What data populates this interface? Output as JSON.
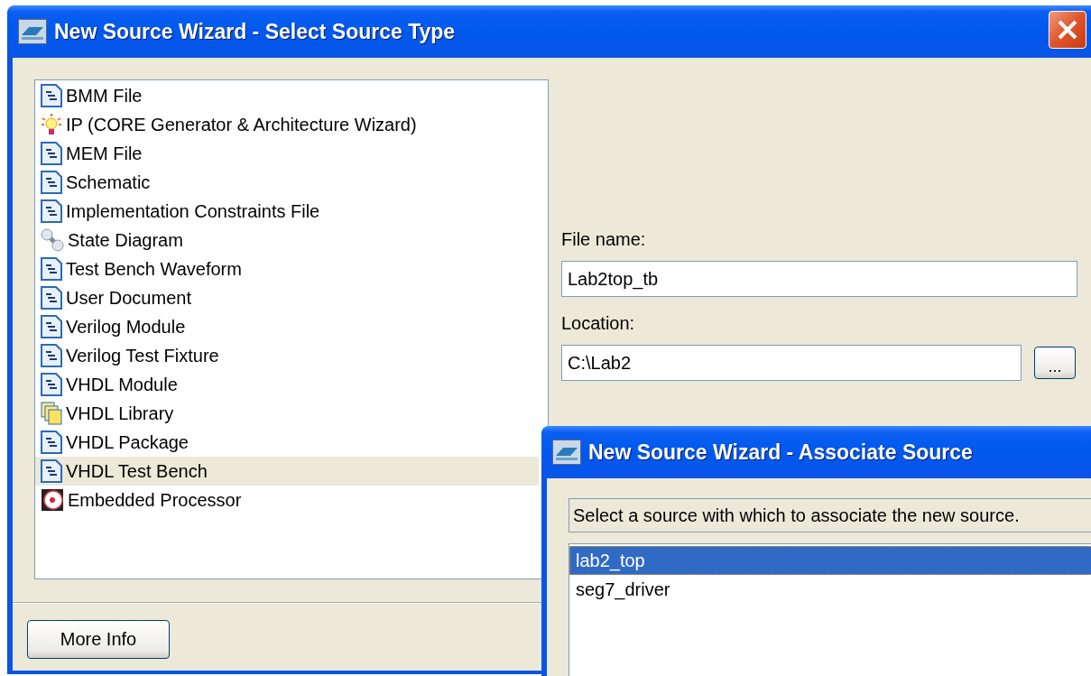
{
  "main_window": {
    "title": "New Source Wizard - Select Source Type",
    "source_types": [
      {
        "label": "BMM File",
        "kind": "document",
        "selected": false
      },
      {
        "label": "IP (CORE Generator & Architecture Wizard)",
        "kind": "bulb",
        "selected": false
      },
      {
        "label": "MEM File",
        "kind": "document",
        "selected": false
      },
      {
        "label": "Schematic",
        "kind": "document",
        "selected": false
      },
      {
        "label": "Implementation Constraints File",
        "kind": "document",
        "selected": false
      },
      {
        "label": "State Diagram",
        "kind": "circles",
        "selected": false
      },
      {
        "label": "Test Bench Waveform",
        "kind": "document",
        "selected": false
      },
      {
        "label": "User Document",
        "kind": "document",
        "selected": false
      },
      {
        "label": "Verilog Module",
        "kind": "document",
        "selected": false
      },
      {
        "label": "Verilog Test Fixture",
        "kind": "document",
        "selected": false
      },
      {
        "label": "VHDL Module",
        "kind": "document",
        "selected": false
      },
      {
        "label": "VHDL Library",
        "kind": "pages",
        "selected": false
      },
      {
        "label": "VHDL Package",
        "kind": "document",
        "selected": false
      },
      {
        "label": "VHDL Test Bench",
        "kind": "document",
        "selected": true
      },
      {
        "label": "Embedded Processor",
        "kind": "disc",
        "selected": false
      }
    ],
    "file_name": {
      "label": "File name:",
      "value": "Lab2top_tb"
    },
    "location": {
      "label": "Location:",
      "value": "C:\\Lab2",
      "browse_button": "..."
    },
    "more_info_button": "More Info"
  },
  "associate_window": {
    "title": "New Source Wizard - Associate Source",
    "instruction": "Select a source with which to associate the new source.",
    "sources": [
      {
        "label": "lab2_top",
        "selected": true
      },
      {
        "label": "seg7_driver",
        "selected": false
      }
    ]
  }
}
